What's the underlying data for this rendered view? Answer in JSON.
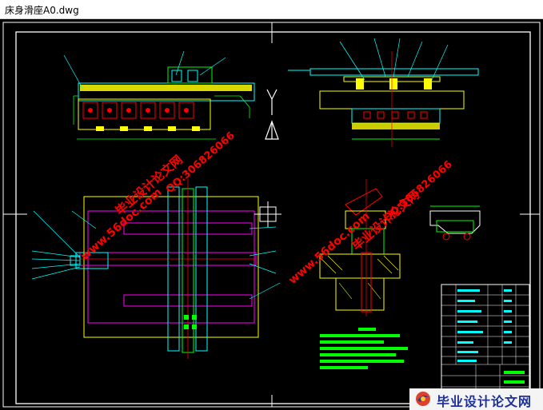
{
  "window": {
    "title": "床身滑座A0.dwg"
  },
  "watermarks": {
    "site_text": "www.56doc.com",
    "brand_text": "毕业设计论文网",
    "qq_text": "QQ:306826066"
  },
  "logo": {
    "text": "毕业设计论文网"
  },
  "colors": {
    "background": "#000000",
    "frame": "#ffffff",
    "drawing_yellow": "#ffff00",
    "drawing_green": "#00ff00",
    "drawing_cyan": "#00ffff",
    "drawing_magenta": "#ff00ff",
    "drawing_red": "#ff0000",
    "watermark": "#ff0000",
    "logo_text": "#1c2f9a"
  },
  "icons": {
    "ucs_axis": "ucs-y-axis-icon",
    "logo_mark": "logo-emblem-icon"
  }
}
